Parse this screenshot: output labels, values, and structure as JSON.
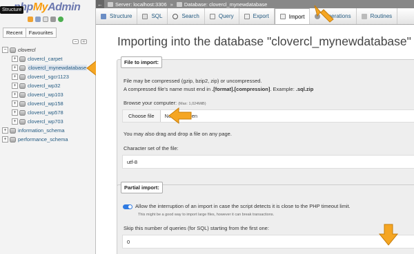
{
  "tooltip": "Structure",
  "logo": {
    "php": "php",
    "my": "My",
    "admin": "Admin"
  },
  "nav": {
    "tabs": [
      "Recent",
      "Favourites"
    ],
    "root": "clovercl",
    "databases": [
      "clovercl_carpet",
      "clovercl_mynewdatabase",
      "clovercl_sgcr1123",
      "clovercl_wp32",
      "clovercl_wp103",
      "clovercl_wp158",
      "clovercl_wp578",
      "clovercl_wp703"
    ],
    "other": [
      "information_schema",
      "performance_schema"
    ],
    "selected": "clovercl_mynewdatabase"
  },
  "breadcrumb": {
    "server": "Server: localhost:3306",
    "separator": "»",
    "database": "Database: clovercl_mynewdatabase"
  },
  "tabs": [
    {
      "label": "Structure",
      "icon": "structure-icon"
    },
    {
      "label": "SQL",
      "icon": "sql-icon"
    },
    {
      "label": "Search",
      "icon": "search-icon"
    },
    {
      "label": "Query",
      "icon": "query-icon"
    },
    {
      "label": "Export",
      "icon": "export-icon"
    },
    {
      "label": "Import",
      "icon": "import-icon",
      "active": true
    },
    {
      "label": "Operations",
      "icon": "operations-icon"
    },
    {
      "label": "Routines",
      "icon": "routines-icon"
    }
  ],
  "main": {
    "title": "Importing into the database \"clovercl_mynewdatabase\"",
    "file_import": {
      "legend": "File to import:",
      "line1": "File may be compressed (gzip, bzip2, zip) or uncompressed.",
      "line2_pre": "A compressed file's name must end in ",
      "line2_bold": ".[format].[compression]",
      "line2_mid": ". Example: ",
      "line2_ex": ".sql.zip",
      "browse_label": "Browse your computer: ",
      "max": "(Max: 1,024MiB)",
      "choose_file": "Choose file",
      "no_file": "No file chosen",
      "drag_drop": "You may also drag and drop a file on any page.",
      "charset_label": "Character set of the file:",
      "charset_value": "utf-8"
    },
    "partial_import": {
      "legend": "Partial import:",
      "allow_interrupt": "Allow the interruption of an import in case the script detects it is close to the PHP timeout limit.",
      "allow_interrupt_note": "This might be a good way to import large files, however it can break transactions.",
      "skip_label": "Skip this number of queries (for SQL) starting from the first one:",
      "skip_value": "0"
    }
  },
  "colors": {
    "accent_arrow": "#f5a623",
    "link": "#235a81",
    "toggle": "#2f7be2"
  }
}
